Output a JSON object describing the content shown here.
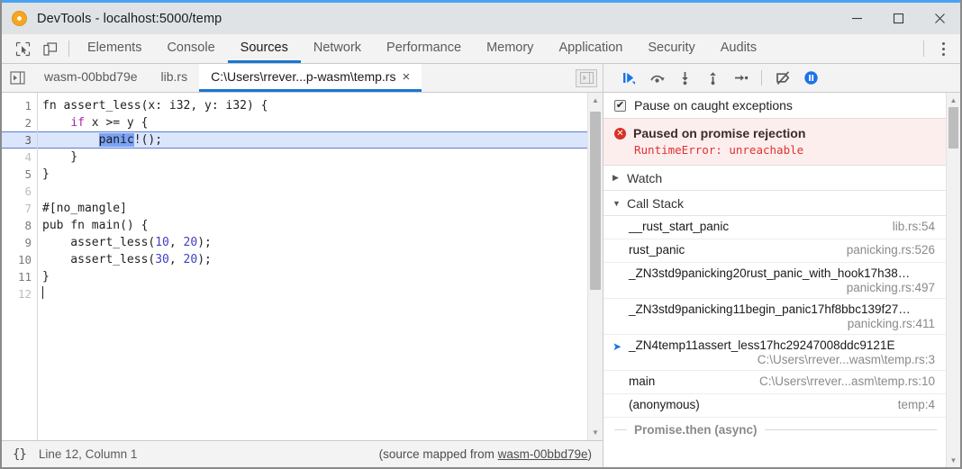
{
  "window": {
    "title": "DevTools - localhost:5000/temp",
    "app_icon": "chrome-devtools-icon",
    "minimize_label": "—",
    "maximize_label": "☐",
    "close_label": "✕"
  },
  "devtools_tabs": {
    "inspect_icon": "inspect-element-icon",
    "device_icon": "device-toolbar-icon",
    "items": [
      {
        "label": "Elements",
        "active": false
      },
      {
        "label": "Console",
        "active": false
      },
      {
        "label": "Sources",
        "active": true
      },
      {
        "label": "Network",
        "active": false
      },
      {
        "label": "Performance",
        "active": false
      },
      {
        "label": "Memory",
        "active": false
      },
      {
        "label": "Application",
        "active": false
      },
      {
        "label": "Security",
        "active": false
      },
      {
        "label": "Audits",
        "active": false
      }
    ],
    "more_icon": "more-options-icon"
  },
  "file_tabs": {
    "navigator_icon": "show-navigator-icon",
    "items": [
      {
        "label": "wasm-00bbd79e",
        "active": false,
        "closable": false
      },
      {
        "label": "lib.rs",
        "active": false,
        "closable": false
      },
      {
        "label": "C:\\Users\\rrever...p-wasm\\temp.rs",
        "active": true,
        "closable": true
      }
    ],
    "close_glyph": "×",
    "collapse_icon": "collapse-sidebar-icon"
  },
  "editor": {
    "lines": [
      {
        "n": "1",
        "dim": false,
        "highlight": false,
        "tokens": [
          {
            "t": "fn assert_less(x: i32, y: i32) {",
            "c": "kw"
          }
        ]
      },
      {
        "n": "2",
        "dim": false,
        "highlight": false,
        "tokens": [
          {
            "t": "    ",
            "c": "kw"
          },
          {
            "t": "if",
            "c": "ctrl"
          },
          {
            "t": " x >= y {",
            "c": "kw"
          }
        ]
      },
      {
        "n": "3",
        "dim": false,
        "highlight": true,
        "tokens": [
          {
            "t": "        ",
            "c": "kw"
          },
          {
            "t": "panic",
            "c": "sel"
          },
          {
            "t": "!();",
            "c": "kw"
          }
        ]
      },
      {
        "n": "4",
        "dim": true,
        "highlight": false,
        "tokens": [
          {
            "t": "    }",
            "c": "kw"
          }
        ]
      },
      {
        "n": "5",
        "dim": false,
        "highlight": false,
        "tokens": [
          {
            "t": "}",
            "c": "kw"
          }
        ]
      },
      {
        "n": "6",
        "dim": true,
        "highlight": false,
        "tokens": [
          {
            "t": "",
            "c": "kw"
          }
        ]
      },
      {
        "n": "7",
        "dim": true,
        "highlight": false,
        "tokens": [
          {
            "t": "#[no_mangle]",
            "c": "kw"
          }
        ]
      },
      {
        "n": "8",
        "dim": false,
        "highlight": false,
        "tokens": [
          {
            "t": "pub fn main() {",
            "c": "kw"
          }
        ]
      },
      {
        "n": "9",
        "dim": false,
        "highlight": false,
        "tokens": [
          {
            "t": "    assert_less(",
            "c": "kw"
          },
          {
            "t": "10",
            "c": "num"
          },
          {
            "t": ", ",
            "c": "kw"
          },
          {
            "t": "20",
            "c": "num"
          },
          {
            "t": ");",
            "c": "kw"
          }
        ]
      },
      {
        "n": "10",
        "dim": false,
        "highlight": false,
        "tokens": [
          {
            "t": "    assert_less(",
            "c": "kw"
          },
          {
            "t": "30",
            "c": "num"
          },
          {
            "t": ", ",
            "c": "kw"
          },
          {
            "t": "20",
            "c": "num"
          },
          {
            "t": ");",
            "c": "kw"
          }
        ]
      },
      {
        "n": "11",
        "dim": false,
        "highlight": false,
        "tokens": [
          {
            "t": "}",
            "c": "kw"
          }
        ]
      },
      {
        "n": "12",
        "dim": true,
        "highlight": false,
        "tokens": []
      }
    ],
    "scroll_up_icon": "scroll-up-arrow-icon",
    "scroll_down_icon": "scroll-down-arrow-icon"
  },
  "statusbar": {
    "format_icon": "{}",
    "position": "Line 12, Column 1",
    "source_map_prefix": "(source mapped from ",
    "source_map_link": "wasm-00bbd79e",
    "source_map_suffix": ")"
  },
  "debugger": {
    "toolbar": [
      {
        "name": "resume-script-execution-icon",
        "label": "Resume"
      },
      {
        "name": "step-over-icon",
        "label": "Step over next function call"
      },
      {
        "name": "step-into-icon",
        "label": "Step into next function call"
      },
      {
        "name": "step-out-icon",
        "label": "Step out of current function"
      },
      {
        "name": "step-icon",
        "label": "Step"
      },
      {
        "name": "deactivate-breakpoints-icon",
        "label": "Deactivate breakpoints"
      },
      {
        "name": "pause-on-exceptions-icon",
        "label": "Pause on exceptions"
      }
    ],
    "pause_on_caught": {
      "label": "Pause on caught exceptions",
      "checked": true,
      "check_glyph": "✔"
    },
    "paused": {
      "title": "Paused on promise rejection",
      "detail": "RuntimeError: unreachable",
      "badge_glyph": "✕"
    },
    "watch": {
      "label": "Watch",
      "expanded": false,
      "triangle": "▶"
    },
    "call_stack": {
      "label": "Call Stack",
      "expanded": true,
      "triangle": "▼",
      "current_marker": "➤",
      "frames": [
        {
          "fn": "__rust_start_panic",
          "loc": "lib.rs:54",
          "wrapped": false,
          "current": false
        },
        {
          "fn": "rust_panic",
          "loc": "panicking.rs:526",
          "wrapped": false,
          "current": false
        },
        {
          "fn": "_ZN3std9panicking20rust_panic_with_hook17h38…",
          "loc": "panicking.rs:497",
          "wrapped": true,
          "current": false
        },
        {
          "fn": "_ZN3std9panicking11begin_panic17hf8bbc139f27…",
          "loc": "panicking.rs:411",
          "wrapped": true,
          "current": false
        },
        {
          "fn": "_ZN4temp11assert_less17hc29247008ddc9121E",
          "loc": "C:\\Users\\rrever...wasm\\temp.rs:3",
          "wrapped": true,
          "current": true
        },
        {
          "fn": "main",
          "loc": "C:\\Users\\rrever...asm\\temp.rs:10",
          "wrapped": false,
          "current": false
        },
        {
          "fn": "(anonymous)",
          "loc": "temp:4",
          "wrapped": false,
          "current": false
        }
      ],
      "async_divider": "Promise.then (async)"
    },
    "scroll_up_icon": "scroll-up-arrow-icon",
    "scroll_down_icon": "scroll-down-arrow-icon"
  },
  "colors": {
    "accent": "#1877d2",
    "error": "#d93025",
    "error_text": "#e03131",
    "highlight_line": "#dbe5fb",
    "selection": "#7aa3f5"
  }
}
